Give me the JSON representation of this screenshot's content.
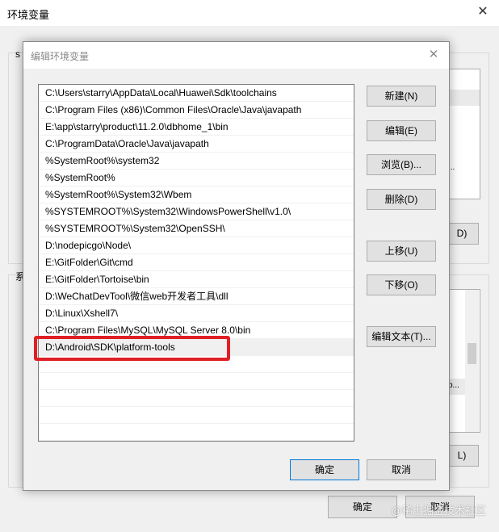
{
  "background_window": {
    "title": "环境变量",
    "fragments": {
      "left_top": "s",
      "left_mid": "系",
      "btn_d_suffix": "D)",
      "btn_l_suffix": "L)",
      "row_dots_1": "...",
      "row_dots_2": "b..."
    },
    "ok_label": "确定",
    "cancel_label": "取消"
  },
  "watermark": "@稀土掘金技术社区",
  "dialog": {
    "title": "编辑环境变量",
    "paths": [
      "C:\\Users\\starry\\AppData\\Local\\Huawei\\Sdk\\toolchains",
      "C:\\Program Files (x86)\\Common Files\\Oracle\\Java\\javapath",
      "E:\\app\\starry\\product\\11.2.0\\dbhome_1\\bin",
      "C:\\ProgramData\\Oracle\\Java\\javapath",
      "%SystemRoot%\\system32",
      "%SystemRoot%",
      "%SystemRoot%\\System32\\Wbem",
      "%SYSTEMROOT%\\System32\\WindowsPowerShell\\v1.0\\",
      "%SYSTEMROOT%\\System32\\OpenSSH\\",
      "D:\\nodepicgo\\Node\\",
      "E:\\GitFolder\\Git\\cmd",
      "E:\\GitFolder\\Tortoise\\bin",
      "D:\\WeChatDevTool\\微信web开发者工具\\dll",
      "D:\\Linux\\Xshell7\\",
      "C:\\Program Files\\MySQL\\MySQL Server 8.0\\bin",
      "D:\\Android\\SDK\\platform-tools"
    ],
    "selected_index": 15,
    "buttons": {
      "new": "新建(N)",
      "edit": "编辑(E)",
      "browse": "浏览(B)...",
      "delete": "删除(D)",
      "move_up": "上移(U)",
      "move_down": "下移(O)",
      "edit_text": "编辑文本(T)..."
    },
    "ok_label": "确定",
    "cancel_label": "取消"
  }
}
